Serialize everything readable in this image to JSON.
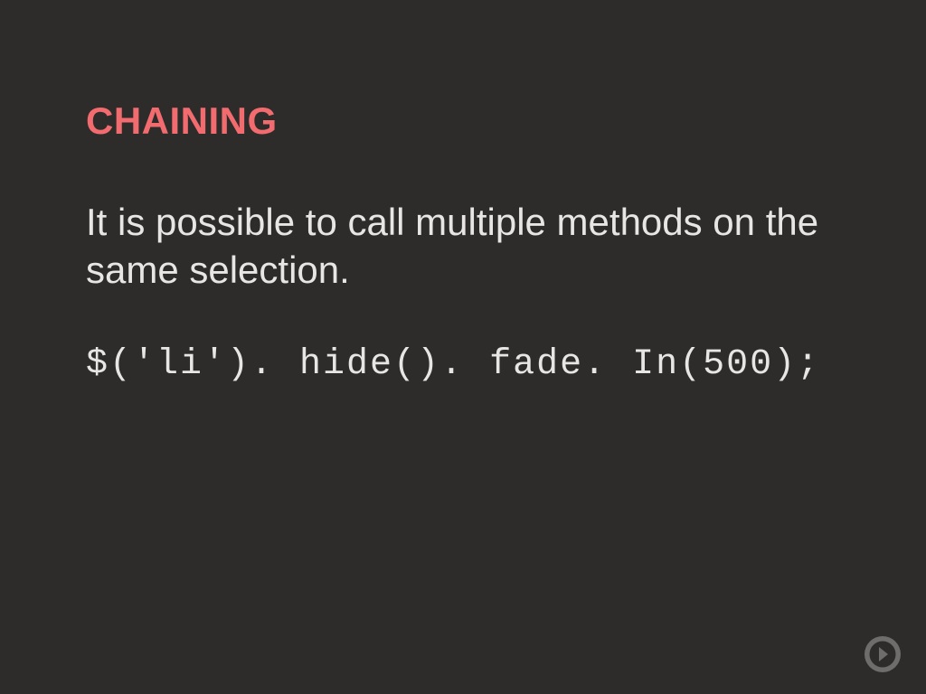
{
  "slide": {
    "title": "CHAINING",
    "body": "It is possible to call multiple methods on the same selection.",
    "code": "$('li'). hide(). fade. In(500);"
  },
  "nav": {
    "next_label": "Next"
  }
}
